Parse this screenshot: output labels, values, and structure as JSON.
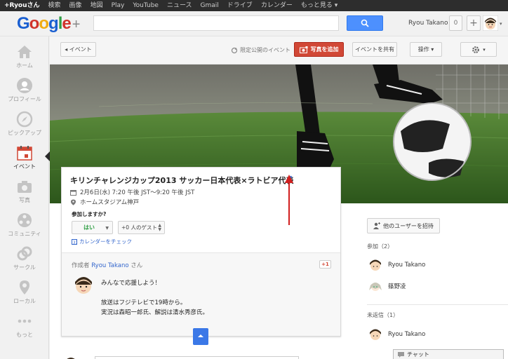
{
  "topbar": {
    "items": [
      "+Ryouさん",
      "検索",
      "画像",
      "地図",
      "Play",
      "YouTube",
      "ニュース",
      "Gmail",
      "ドライブ",
      "カレンダー",
      "もっと見る ▾"
    ]
  },
  "header": {
    "logo_text": "Google",
    "logo_plus": "+",
    "search_placeholder": "",
    "user_name": "Ryou Takano",
    "notification_count": "0",
    "share_plus": "+"
  },
  "nav": {
    "items": [
      {
        "label": "ホーム",
        "icon": "home-icon"
      },
      {
        "label": "プロフィール",
        "icon": "profile-icon"
      },
      {
        "label": "ピックアップ",
        "icon": "compass-icon"
      },
      {
        "label": "イベント",
        "icon": "calendar-icon"
      },
      {
        "label": "写真",
        "icon": "camera-icon"
      },
      {
        "label": "コミュニティ",
        "icon": "community-icon"
      },
      {
        "label": "サークル",
        "icon": "circles-icon"
      },
      {
        "label": "ローカル",
        "icon": "map-pin-icon"
      },
      {
        "label": "もっと",
        "icon": "more-icon"
      }
    ]
  },
  "toolbar": {
    "back_label": "◂  イベント",
    "limited_label": "限定公開のイベント",
    "photo_label": "写真を追加",
    "share_label": "イベントを共有",
    "ops_label": "操作  ▾",
    "gear_caret": "▾"
  },
  "event": {
    "title": "キリンチャレンジカップ2013 サッカー日本代表×ラトビア代表",
    "date": "2月6日(水) 7:20 午後 JST～9:20 午後 JST",
    "place": "ホームスタジアム神戸",
    "attend_question": "参加しますか?",
    "yes_label": "はい",
    "guest_label": "+0 人のゲスト",
    "calendar_check": "カレンダーをチェック",
    "author_prefix": "作成者",
    "author_name": "Ryou Takano",
    "author_suffix": "さん",
    "plus_one": "+1",
    "post_lines": [
      "みんなで応援しよう！",
      "",
      "放送はフジテレビで19時から。",
      "実況は森昭一郎氏、解説は清水秀彦氏。"
    ]
  },
  "right": {
    "invite_label": "他のユーザーを招待",
    "attending_head": "参加（2）",
    "attending": [
      "Ryou Takano",
      "篠野凌"
    ],
    "unreplied_head": "未返信（1）",
    "unreplied": [
      "Ryou Takano"
    ]
  },
  "chat": {
    "label": "チャット"
  },
  "colors": {
    "accent_blue": "#4d90fe",
    "photo_button_red": "#d14836",
    "annotation_red": "#d11f1f",
    "yes_green": "#2f9e44"
  }
}
